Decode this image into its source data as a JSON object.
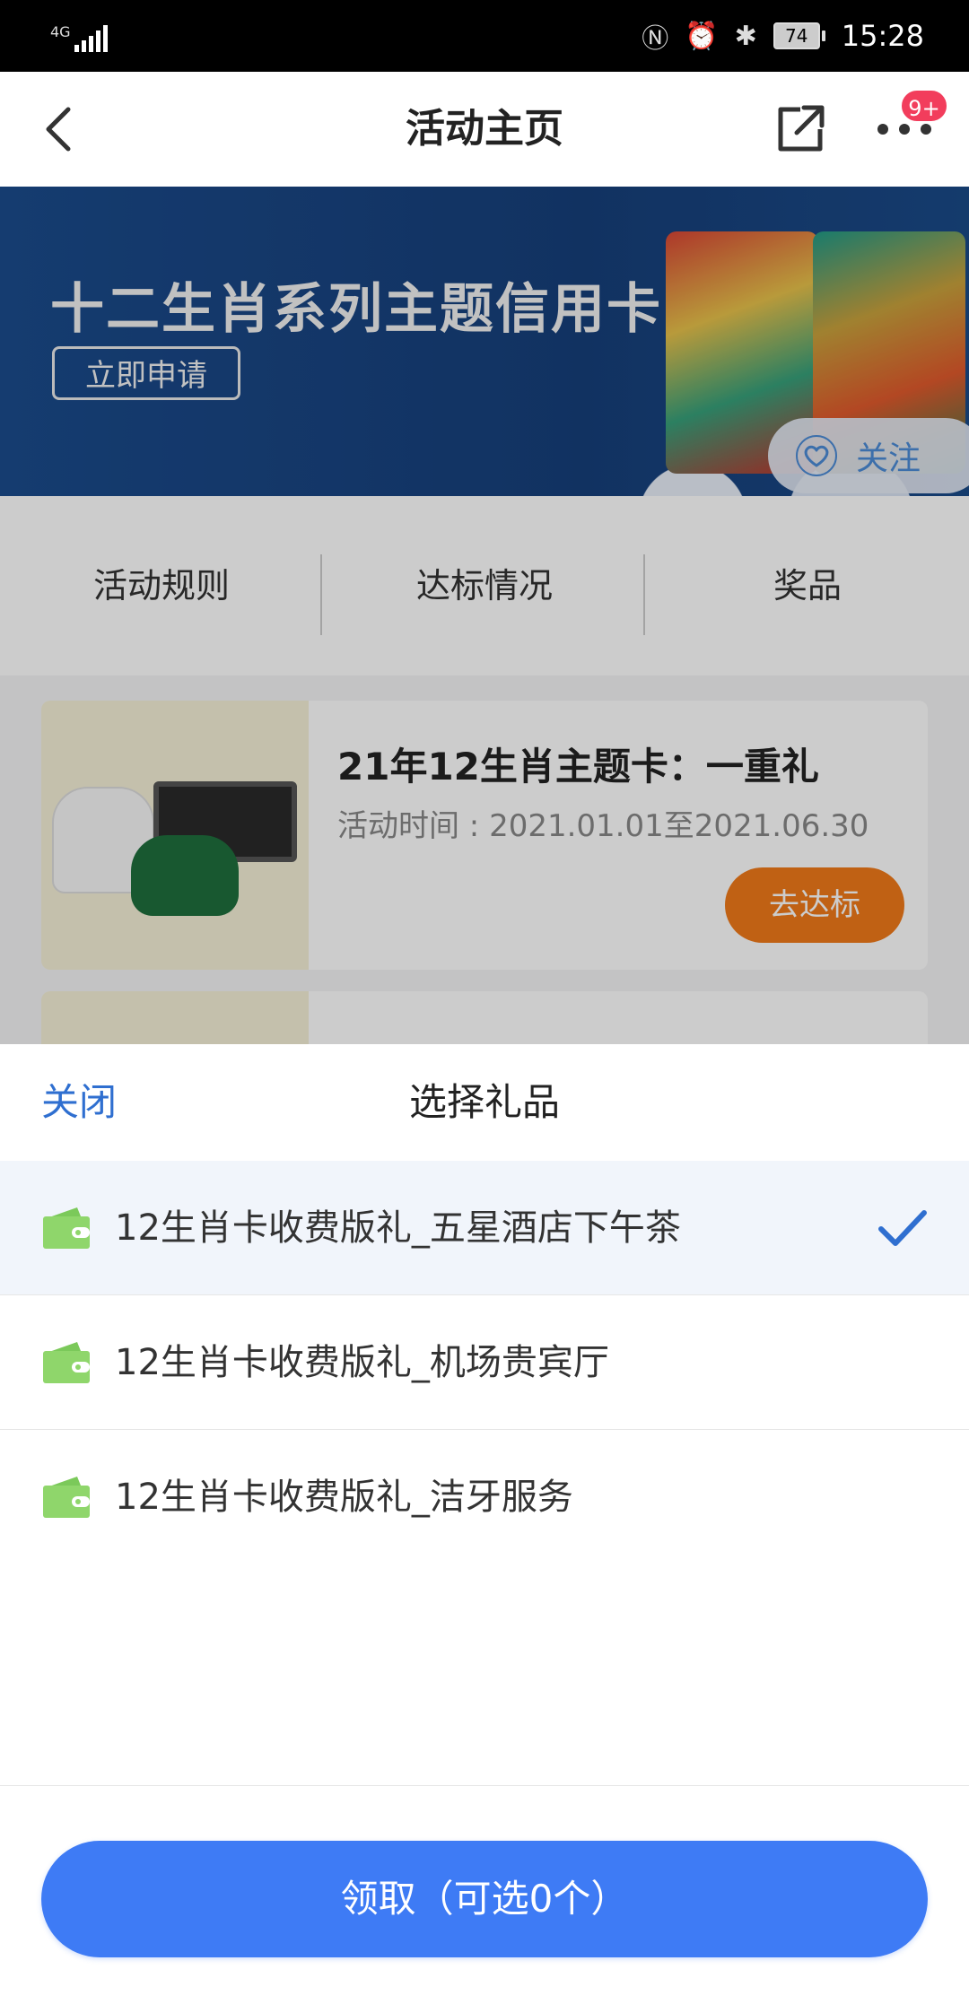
{
  "status_bar": {
    "network": "4G",
    "battery": "74",
    "time": "15:28"
  },
  "nav": {
    "title": "活动主页",
    "badge": "9+"
  },
  "banner": {
    "title": "十二生肖系列主题信用卡",
    "apply_label": "立即申请",
    "follow_label": "关注"
  },
  "tabs": [
    "活动规则",
    "达标情况",
    "奖品"
  ],
  "activity": {
    "title": "21年12生肖主题卡：一重礼",
    "time": "活动时间 : 2021.01.01至2021.06.30",
    "button_label": "去达标"
  },
  "sheet": {
    "close_label": "关闭",
    "title": "选择礼品",
    "gifts": [
      {
        "label": "12生肖卡收费版礼_五星酒店下午茶",
        "selected": true
      },
      {
        "label": "12生肖卡收费版礼_机场贵宾厅",
        "selected": false
      },
      {
        "label": "12生肖卡收费版礼_洁牙服务",
        "selected": false
      }
    ],
    "claim_label": "领取（可选0个）"
  },
  "colors": {
    "accent_blue": "#3e7bf5",
    "link_blue": "#2f6fd0",
    "orange": "#f07a1a",
    "gift_icon_green": "#8fd66b",
    "badge_red": "#f23d5c"
  }
}
